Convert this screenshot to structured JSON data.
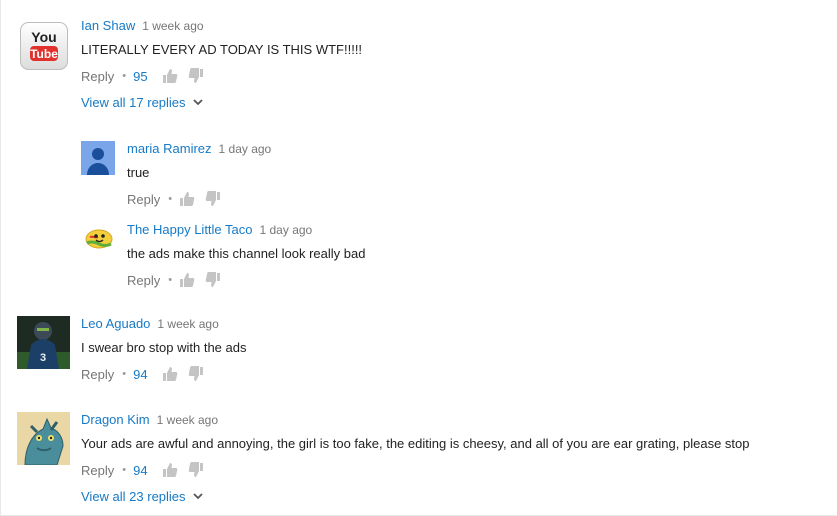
{
  "colors": {
    "link": "#167ac6",
    "meta": "#767676",
    "text": "#222222"
  },
  "comments": [
    {
      "author": "Ian Shaw",
      "time": "1 week ago",
      "text": "LITERALLY EVERY AD TODAY IS THIS WTF!!!!!",
      "reply": "Reply",
      "likes": "95",
      "view_replies": "View all 17 replies",
      "avatar": "youtube-logo-avatar",
      "avatar_text": [
        "You",
        "Tube"
      ]
    },
    {
      "author": "maria Ramirez",
      "time": "1 day ago",
      "text": "true",
      "reply": "Reply",
      "avatar": "default-person-avatar"
    },
    {
      "author": "The Happy Little Taco",
      "time": "1 day ago",
      "text": "the ads make this channel look really bad",
      "reply": "Reply",
      "avatar": "taco-avatar"
    },
    {
      "author": "Leo Aguado",
      "time": "1 week ago",
      "text": "I swear bro stop with the ads",
      "reply": "Reply",
      "likes": "94",
      "avatar": "football-player-avatar"
    },
    {
      "author": "Dragon Kim",
      "time": "1 week ago",
      "text": "Your ads are awful and annoying, the girl is too fake, the editing is cheesy, and all of you are ear grating, please stop",
      "reply": "Reply",
      "likes": "94",
      "view_replies": "View all 23 replies",
      "avatar": "dragon-avatar"
    }
  ]
}
